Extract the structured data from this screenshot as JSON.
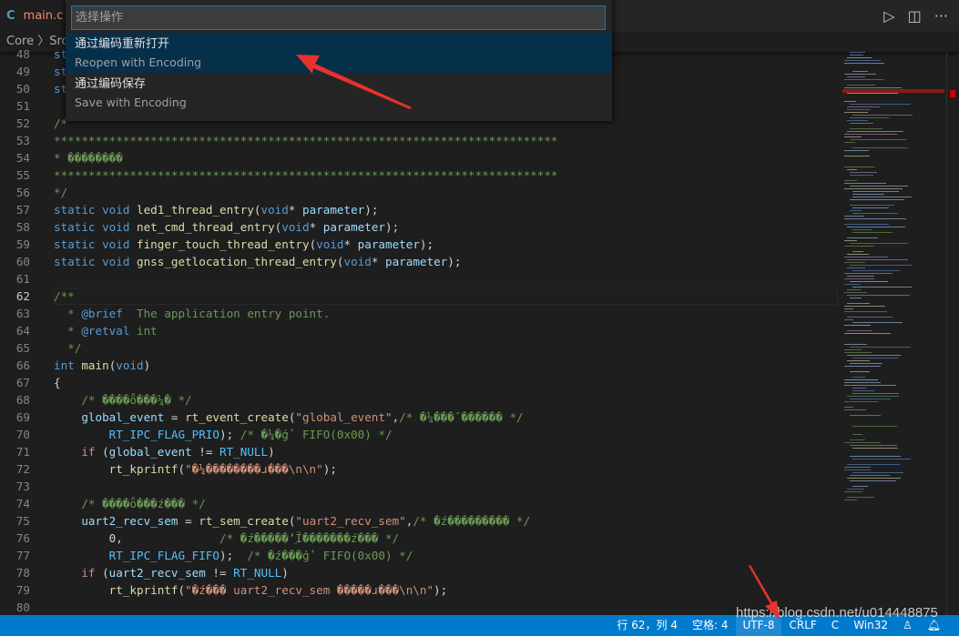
{
  "tab": {
    "icon": "C",
    "name": "main.c"
  },
  "toolbar": {
    "run_icon": "play-icon",
    "split_icon": "split-editor-icon",
    "more_icon": "ellipsis-icon"
  },
  "breadcrumb": "Core 〉Src",
  "quick_pick": {
    "placeholder": "选择操作",
    "items": [
      {
        "label": "通过编码重新打开",
        "detail": "Reopen with Encoding",
        "selected": true
      },
      {
        "label": "通过编码保存",
        "detail": "Save with Encoding",
        "selected": false
      }
    ]
  },
  "editor": {
    "current_line": 62,
    "first_line": 48,
    "lines": [
      [
        [
          "kw",
          "st"
        ]
      ],
      [
        [
          "kw",
          "st"
        ]
      ],
      [
        [
          "kw",
          "st"
        ]
      ],
      [],
      [
        [
          "cm",
          "/*"
        ]
      ],
      [
        [
          "cm",
          "*************************************************************************"
        ]
      ],
      [
        [
          "cm",
          "* ��������"
        ]
      ],
      [
        [
          "cm",
          "*************************************************************************"
        ]
      ],
      [
        [
          "cm",
          "*/"
        ]
      ],
      [
        [
          "kw",
          "static void "
        ],
        [
          "fn",
          "led1_thread_entry"
        ],
        [
          "p",
          "("
        ],
        [
          "kw",
          "void"
        ],
        [
          "p",
          "* "
        ],
        [
          "var",
          "parameter"
        ],
        [
          "p",
          ");"
        ]
      ],
      [
        [
          "kw",
          "static void "
        ],
        [
          "fn",
          "net_cmd_thread_entry"
        ],
        [
          "p",
          "("
        ],
        [
          "kw",
          "void"
        ],
        [
          "p",
          "* "
        ],
        [
          "var",
          "parameter"
        ],
        [
          "p",
          ");"
        ]
      ],
      [
        [
          "kw",
          "static void "
        ],
        [
          "fn",
          "finger_touch_thread_entry"
        ],
        [
          "p",
          "("
        ],
        [
          "kw",
          "void"
        ],
        [
          "p",
          "* "
        ],
        [
          "var",
          "parameter"
        ],
        [
          "p",
          ");"
        ]
      ],
      [
        [
          "kw",
          "static void "
        ],
        [
          "fn",
          "gnss_getlocation_thread_entry"
        ],
        [
          "p",
          "("
        ],
        [
          "kw",
          "void"
        ],
        [
          "p",
          "* "
        ],
        [
          "var",
          "parameter"
        ],
        [
          "p",
          ");"
        ]
      ],
      [],
      [
        [
          "cm",
          "/**"
        ]
      ],
      [
        [
          "cm",
          "  * "
        ],
        [
          "kw",
          "@brief"
        ],
        [
          "cm",
          "  The application entry point."
        ]
      ],
      [
        [
          "cm",
          "  * "
        ],
        [
          "kw",
          "@retval"
        ],
        [
          "cm",
          " int"
        ]
      ],
      [
        [
          "cm",
          "  */"
        ]
      ],
      [
        [
          "kw",
          "int "
        ],
        [
          "fn",
          "main"
        ],
        [
          "p",
          "("
        ],
        [
          "kw",
          "void"
        ],
        [
          "p",
          ")"
        ]
      ],
      [
        [
          "p",
          "{"
        ]
      ],
      [
        [
          "cm",
          "    /* ����ȫ���¼� */"
        ]
      ],
      [
        [
          "var",
          "    global_event"
        ],
        [
          "p",
          " = "
        ],
        [
          "fn",
          "rt_event_create"
        ],
        [
          "p",
          "("
        ],
        [
          "str",
          "\"global_event\""
        ],
        [
          "p",
          ","
        ],
        [
          "cm",
          "/* �¼���¯������ */"
        ]
      ],
      [
        [
          "mac",
          "        RT_IPC_FLAG_PRIO"
        ],
        [
          "p",
          "); "
        ],
        [
          "cm",
          "/* �¼�ģʽ FIFO(0x00) */"
        ]
      ],
      [
        [
          "ctl",
          "    if"
        ],
        [
          "p",
          " ("
        ],
        [
          "var",
          "global_event"
        ],
        [
          "p",
          " != "
        ],
        [
          "mac",
          "RT_NULL"
        ],
        [
          "p",
          ")"
        ]
      ],
      [
        [
          "fn",
          "        rt_kprintf"
        ],
        [
          "p",
          "("
        ],
        [
          "str",
          "\"�¼��������ɹ���\\n\\n\""
        ],
        [
          "p",
          ");"
        ]
      ],
      [],
      [
        [
          "cm",
          "    /* ����ȫ���ź��� */"
        ]
      ],
      [
        [
          "var",
          "    uart2_recv_sem"
        ],
        [
          "p",
          " = "
        ],
        [
          "fn",
          "rt_sem_create"
        ],
        [
          "p",
          "("
        ],
        [
          "str",
          "\"uart2_recv_sem\""
        ],
        [
          "p",
          ","
        ],
        [
          "cm",
          "/* �ź��������� */"
        ]
      ],
      [
        [
          "p",
          "        0,              "
        ],
        [
          "cm",
          "/* �ź�����ʼֵΪ�������ź��� */"
        ]
      ],
      [
        [
          "mac",
          "        RT_IPC_FLAG_FIFO"
        ],
        [
          "p",
          ");  "
        ],
        [
          "cm",
          "/* �ź���ģʽ FIFO(0x00) */"
        ]
      ],
      [
        [
          "ctl",
          "    if"
        ],
        [
          "p",
          " ("
        ],
        [
          "var",
          "uart2_recv_sem"
        ],
        [
          "p",
          " != "
        ],
        [
          "mac",
          "RT_NULL"
        ],
        [
          "p",
          ")"
        ]
      ],
      [
        [
          "fn",
          "        rt_kprintf"
        ],
        [
          "p",
          "("
        ],
        [
          "str",
          "\"�ź��� uart2_recv_sem �����ɹ���\\n\\n\""
        ],
        [
          "p",
          ");"
        ]
      ],
      []
    ]
  },
  "status": {
    "position": "行 62，列 4",
    "indent": "空格: 4",
    "encoding": "UTF-8",
    "eol": "CRLF",
    "language": "C",
    "platform": "Win32",
    "feedback_icon": "person-feedback-icon",
    "bell_icon": "bell-icon"
  },
  "watermark": "https://blog.csdn.net/u014448875",
  "colors": {
    "status_bar": "#007acc",
    "selection": "#062f4a",
    "accent": "#007fd4",
    "annotation_arrow": "#e8322d"
  }
}
